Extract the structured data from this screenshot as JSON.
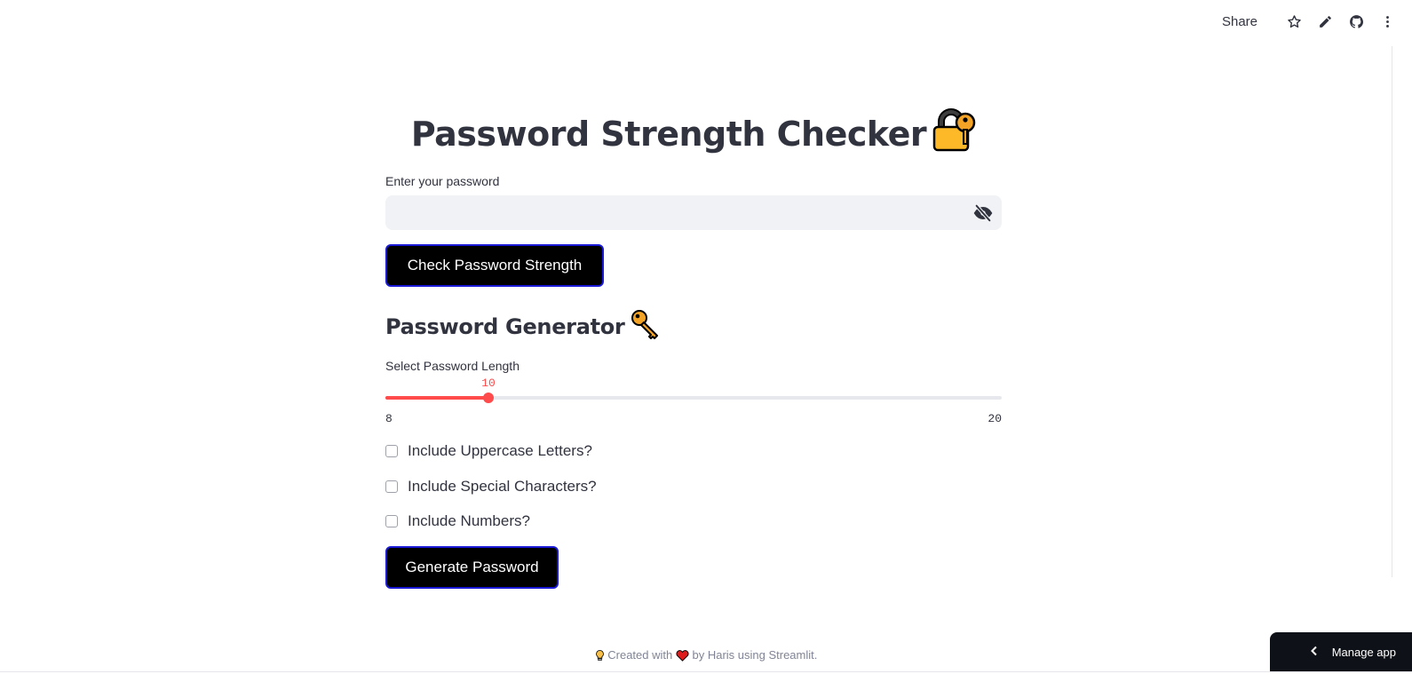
{
  "toolbar": {
    "share_label": "Share",
    "icons": [
      "star-icon",
      "pencil-icon",
      "github-icon",
      "more-vertical-icon"
    ]
  },
  "main": {
    "title": "Password Strength Checker",
    "title_icon": "locked-with-key-icon",
    "password_label": "Enter your password",
    "password_value": "",
    "password_placeholder": "",
    "visibility_icon": "eye-slash-icon",
    "check_button": "Check Password Strength",
    "generator_heading": "Password Generator",
    "generator_icon": "key-icon",
    "length_label": "Select Password Length",
    "slider": {
      "min": 8,
      "max": 20,
      "value": 10,
      "min_label": "8",
      "max_label": "20",
      "value_label": "10"
    },
    "options": [
      {
        "label": "Include Uppercase Letters?",
        "checked": false
      },
      {
        "label": "Include Special Characters?",
        "checked": false
      },
      {
        "label": "Include Numbers?",
        "checked": false
      }
    ],
    "generate_button": "Generate Password"
  },
  "footer": {
    "prefix": "Created with",
    "suffix": "by Haris using Streamlit.",
    "icons": [
      "lightbulb-icon",
      "heart-icon"
    ]
  },
  "manage_app": {
    "label": "Manage app",
    "icon": "chevron-left-icon"
  },
  "colors": {
    "accent": "#ff4b4b",
    "button_bg": "#000000",
    "button_border": "#1a1ad6",
    "input_bg": "#f0f2f6",
    "text": "#31333f"
  }
}
